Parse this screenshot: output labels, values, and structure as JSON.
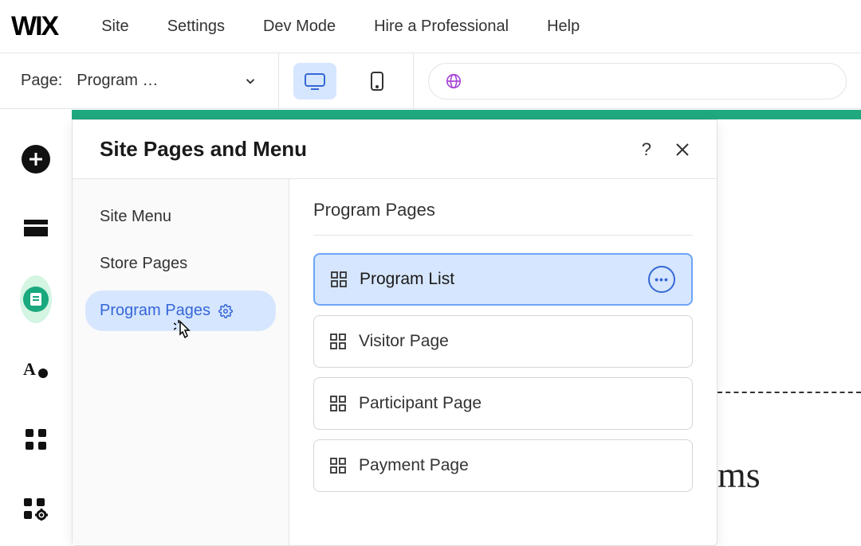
{
  "topnav": {
    "logo": "WIX",
    "items": [
      "Site",
      "Settings",
      "Dev Mode",
      "Hire a Professional",
      "Help"
    ]
  },
  "secondbar": {
    "page_label": "Page:",
    "page_value": "Program …"
  },
  "panel": {
    "title": "Site Pages and Menu",
    "sidebar": [
      {
        "label": "Site Menu",
        "active": false
      },
      {
        "label": "Store Pages",
        "active": false
      },
      {
        "label": "Program Pages",
        "active": true
      }
    ],
    "content_heading": "Program Pages",
    "pages": [
      {
        "label": "Program List",
        "selected": true
      },
      {
        "label": "Visitor Page",
        "selected": false
      },
      {
        "label": "Participant Page",
        "selected": false
      },
      {
        "label": "Payment Page",
        "selected": false
      }
    ]
  },
  "background": {
    "partial_text": "ms"
  }
}
